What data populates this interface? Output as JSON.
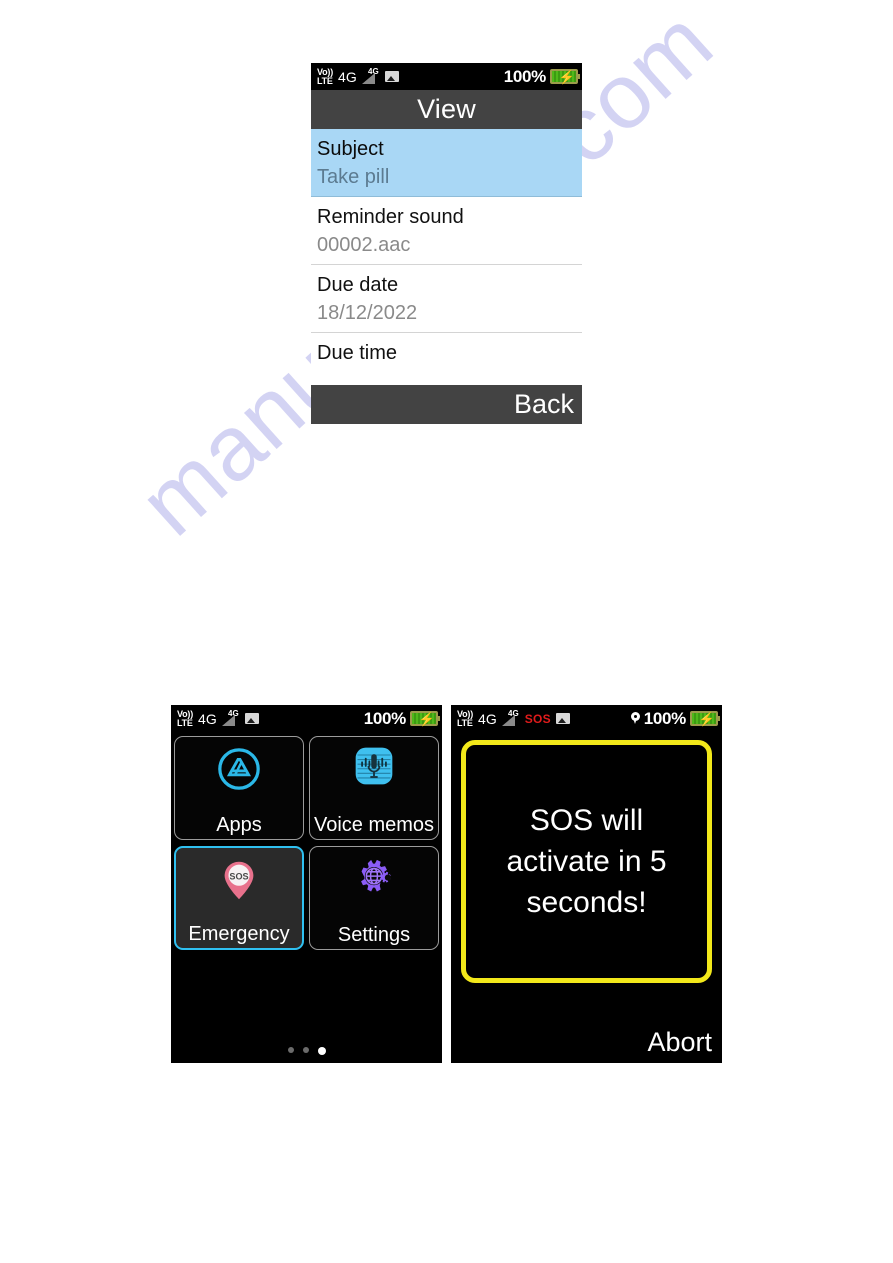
{
  "page": {
    "watermark": "manualshive.com"
  },
  "view_screen": {
    "status_bar": {
      "volte_top": "Vo))",
      "volte_bottom": "LTE",
      "network": "4G",
      "signal_badge": "4G",
      "picture_icon": "picture-icon",
      "battery_percent": "100%",
      "battery_icon": "battery-charging-icon"
    },
    "title": "View",
    "rows": [
      {
        "label": "Subject",
        "value": "Take pill",
        "selected": true
      },
      {
        "label": "Reminder sound",
        "value": "00002.aac",
        "selected": false
      },
      {
        "label": "Due date",
        "value": "18/12/2022",
        "selected": false
      },
      {
        "label": "Due time",
        "value": "",
        "selected": false
      }
    ],
    "softkey_right": "Back"
  },
  "home_screen": {
    "status_bar": {
      "volte_top": "Vo))",
      "volte_bottom": "LTE",
      "network": "4G",
      "signal_badge": "4G",
      "picture_icon": "picture-icon",
      "battery_percent": "100%",
      "battery_icon": "battery-charging-icon"
    },
    "tiles": [
      {
        "label": "Apps",
        "icon": "app-store-icon",
        "selected": false
      },
      {
        "label": "Voice memos",
        "icon": "voice-memo-icon",
        "selected": false
      },
      {
        "label": "Emergency",
        "icon": "sos-pin-icon",
        "selected": true
      },
      {
        "label": "Settings",
        "icon": "settings-gear-globe-icon",
        "selected": false
      }
    ],
    "page_dots": {
      "count": 3,
      "active_index": 2
    }
  },
  "sos_screen": {
    "status_bar": {
      "volte_top": "Vo))",
      "volte_bottom": "LTE",
      "network": "4G",
      "signal_badge": "4G",
      "sos_indicator": "SOS",
      "picture_icon": "picture-icon",
      "location_icon": "location-pin-icon",
      "battery_percent": "100%",
      "battery_icon": "battery-charging-icon"
    },
    "message": "SOS will activate in 5 seconds!",
    "softkey_right": "Abort"
  },
  "colors": {
    "selected_row": "#a9d7f5",
    "title_bar": "#434343",
    "sos_border": "#f2e81a",
    "tile_selected_border": "#2fc0f0",
    "sos_indicator": "#e01b1b"
  }
}
